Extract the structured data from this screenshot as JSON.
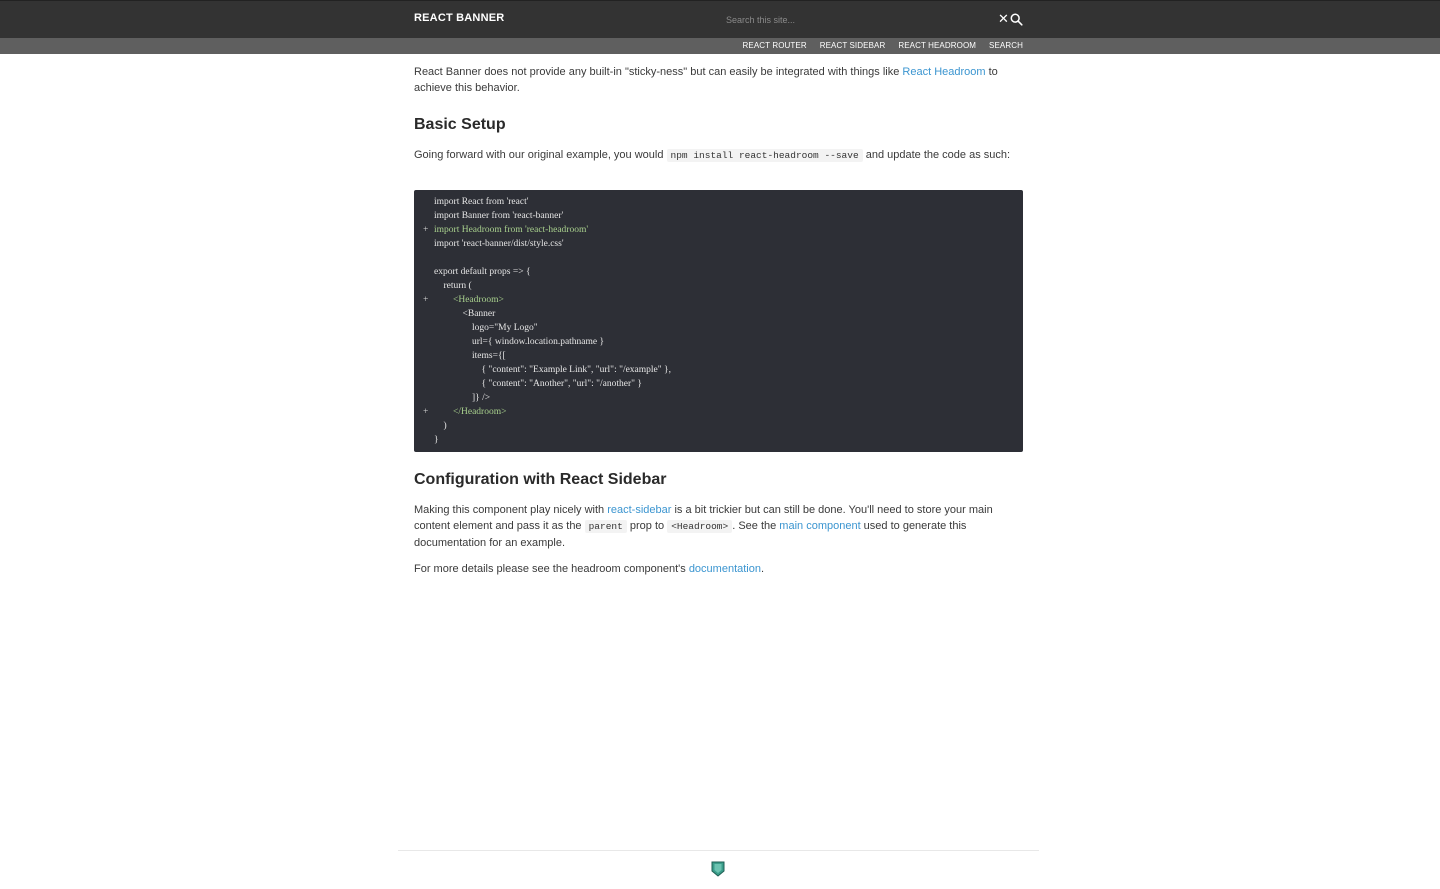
{
  "header": {
    "brand": "REACT BANNER",
    "search_placeholder": "Search this site...",
    "clear_icon": "close-icon",
    "search_icon": "search-icon"
  },
  "subnav": {
    "items": [
      "REACT ROUTER",
      "REACT SIDEBAR",
      "REACT HEADROOM",
      "SEARCH"
    ]
  },
  "intro": {
    "text_before": "React Banner does not provide any built-in \"sticky-ness\" but can easily be integrated with things like ",
    "link": "React Headroom",
    "text_after": " to achieve this behavior."
  },
  "basic_setup": {
    "heading": "Basic Setup",
    "text_before": "Going forward with our original example, you would ",
    "code": "npm install react-headroom --save",
    "text_after": " and update the code as such:"
  },
  "code_block": {
    "lines": [
      {
        "mark": "",
        "added": false,
        "text": "import React from 'react'"
      },
      {
        "mark": "",
        "added": false,
        "text": "import Banner from 'react-banner'"
      },
      {
        "mark": "+",
        "added": true,
        "text": "import Headroom from 'react-headroom'"
      },
      {
        "mark": "",
        "added": false,
        "text": "import 'react-banner/dist/style.css'"
      },
      {
        "mark": "",
        "added": false,
        "text": ""
      },
      {
        "mark": "",
        "added": false,
        "text": "export default props => {"
      },
      {
        "mark": "",
        "added": false,
        "text": "    return ("
      },
      {
        "mark": "+",
        "added": true,
        "text": "        <Headroom>"
      },
      {
        "mark": "",
        "added": false,
        "text": "            <Banner"
      },
      {
        "mark": "",
        "added": false,
        "text": "                logo=\"My Logo\""
      },
      {
        "mark": "",
        "added": false,
        "text": "                url={ window.location.pathname }"
      },
      {
        "mark": "",
        "added": false,
        "text": "                items={["
      },
      {
        "mark": "",
        "added": false,
        "text": "                    { \"content\": \"Example Link\", \"url\": \"/example\" },"
      },
      {
        "mark": "",
        "added": false,
        "text": "                    { \"content\": \"Another\", \"url\": \"/another\" }"
      },
      {
        "mark": "",
        "added": false,
        "text": "                ]} />"
      },
      {
        "mark": "+",
        "added": true,
        "text": "        </Headroom>"
      },
      {
        "mark": "",
        "added": false,
        "text": "    )"
      },
      {
        "mark": "",
        "added": false,
        "text": "}"
      }
    ]
  },
  "config": {
    "heading": "Configuration with React Sidebar",
    "text_1": "Making this component play nicely with ",
    "link_1": "react-sidebar",
    "text_2": " is a bit trickier but can still be done. You'll need to store your main content element and pass it as the ",
    "code_1": "parent",
    "text_3": " prop to ",
    "code_2": "<Headroom>",
    "text_4": ". See the ",
    "link_2": "main component",
    "text_5": " used to generate this documentation for an example."
  },
  "more": {
    "text_before": "For more details please see the headroom component's ",
    "link": "documentation",
    "text_after": "."
  },
  "footer": {
    "logo_icon": "shield-logo-icon"
  },
  "colors": {
    "topbar": "#333333",
    "subnav": "#5f5f5f",
    "link": "#3b95d0",
    "code_bg": "#2d2f36",
    "code_added": "#a8d08d",
    "logo": "#3a9d8a"
  }
}
